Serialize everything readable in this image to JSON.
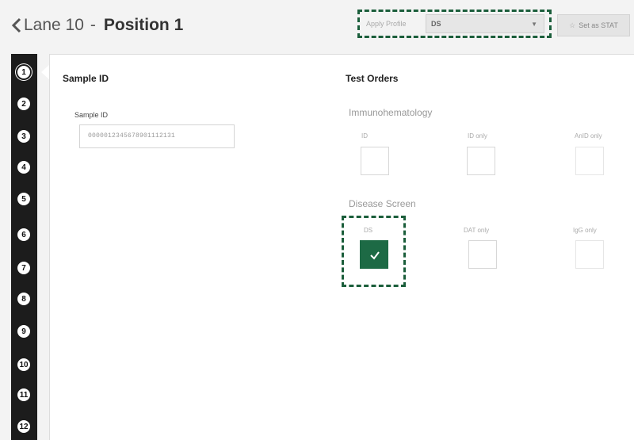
{
  "header": {
    "back_label": "Lane 10",
    "title_separator": "-",
    "position_label": "Position 1",
    "profile_label": "Apply Profile",
    "profile_value": "DS",
    "stat_label": "Set as STAT"
  },
  "steps": [
    "1",
    "2",
    "3",
    "4",
    "5",
    "6",
    "7",
    "8",
    "9",
    "10",
    "11",
    "12"
  ],
  "active_step": "1",
  "sample": {
    "section_title": "Sample ID",
    "field_label": "Sample ID",
    "field_value": "0000012345678901112131"
  },
  "orders": {
    "section_title": "Test Orders",
    "groups": [
      {
        "title": "Immunohematology",
        "tests": [
          {
            "label": "ID",
            "checked": false
          },
          {
            "label": "ID only",
            "checked": false
          },
          {
            "label": "AnID only",
            "checked": false
          }
        ]
      },
      {
        "title": "Disease Screen",
        "tests": [
          {
            "label": "DS",
            "checked": true
          },
          {
            "label": "DAT only",
            "checked": false
          },
          {
            "label": "IgG only",
            "checked": false
          }
        ]
      }
    ]
  },
  "colors": {
    "accent": "#1d6a45",
    "highlight": "#1b5e3b",
    "sidebar": "#1c1c1c"
  }
}
